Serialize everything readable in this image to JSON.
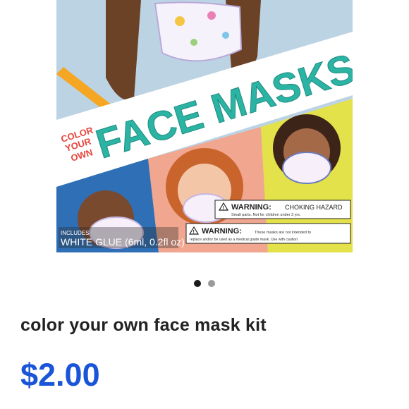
{
  "product": {
    "image_alt": "Color Your Own Face Masks kit packaging",
    "box": {
      "brand_lines": [
        "COLOR",
        "YOUR",
        "OWN"
      ],
      "title": "FACE MASKS",
      "includes_label": "INCLUDES",
      "includes_item": "WHITE GLUE (6ml, 0.2fl oz)",
      "warning1_title": "WARNING:",
      "warning1_hazard": "CHOKING HAZARD",
      "warning1_detail": "Small parts. Not for children under 3 yrs.",
      "warning2_title": "WARNING:",
      "warning2_line1": "These masks are not intended to",
      "warning2_line2": "replace and/or be used as a medical grade mask. Use with caution."
    },
    "carousel": {
      "count": 2,
      "active_index": 0
    },
    "title": "color your own face mask kit",
    "price": "$2.00"
  },
  "colors": {
    "price": "#1a55d8",
    "title": "#222222",
    "box_teal": "#2bb3a4",
    "box_red": "#e8453c",
    "dot_active": "#1a1a1a",
    "dot_inactive": "#9a9a9a"
  },
  "icons": [
    "warning-triangle-icon"
  ]
}
